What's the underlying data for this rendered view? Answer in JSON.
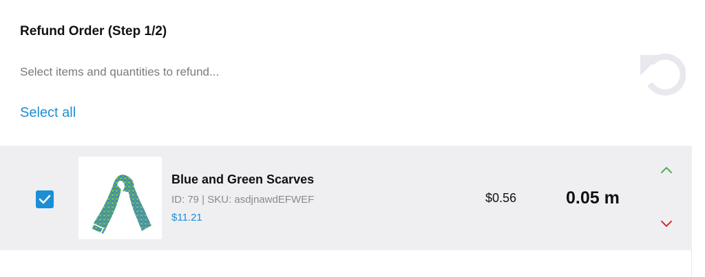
{
  "header": {
    "title": "Refund Order (Step 1/2)",
    "subtitle": "Select items and quantities to refund...",
    "select_all_label": "Select all",
    "reset_icon": "undo-icon"
  },
  "items": [
    {
      "checked": true,
      "name": "Blue and Green Scarves",
      "meta": "ID: 79 | SKU: asdjnawdEFWEF",
      "price": "$11.21",
      "refund_amount": "$0.56",
      "quantity": "0.05 m",
      "increase_icon": "chevron-up-icon",
      "decrease_icon": "chevron-down-icon"
    }
  ],
  "colors": {
    "accent": "#1a8fd6",
    "row_background": "#efeff2",
    "increase": "#4caf50",
    "decrease": "#d32f2f",
    "icon_muted": "#e8e8ee"
  }
}
